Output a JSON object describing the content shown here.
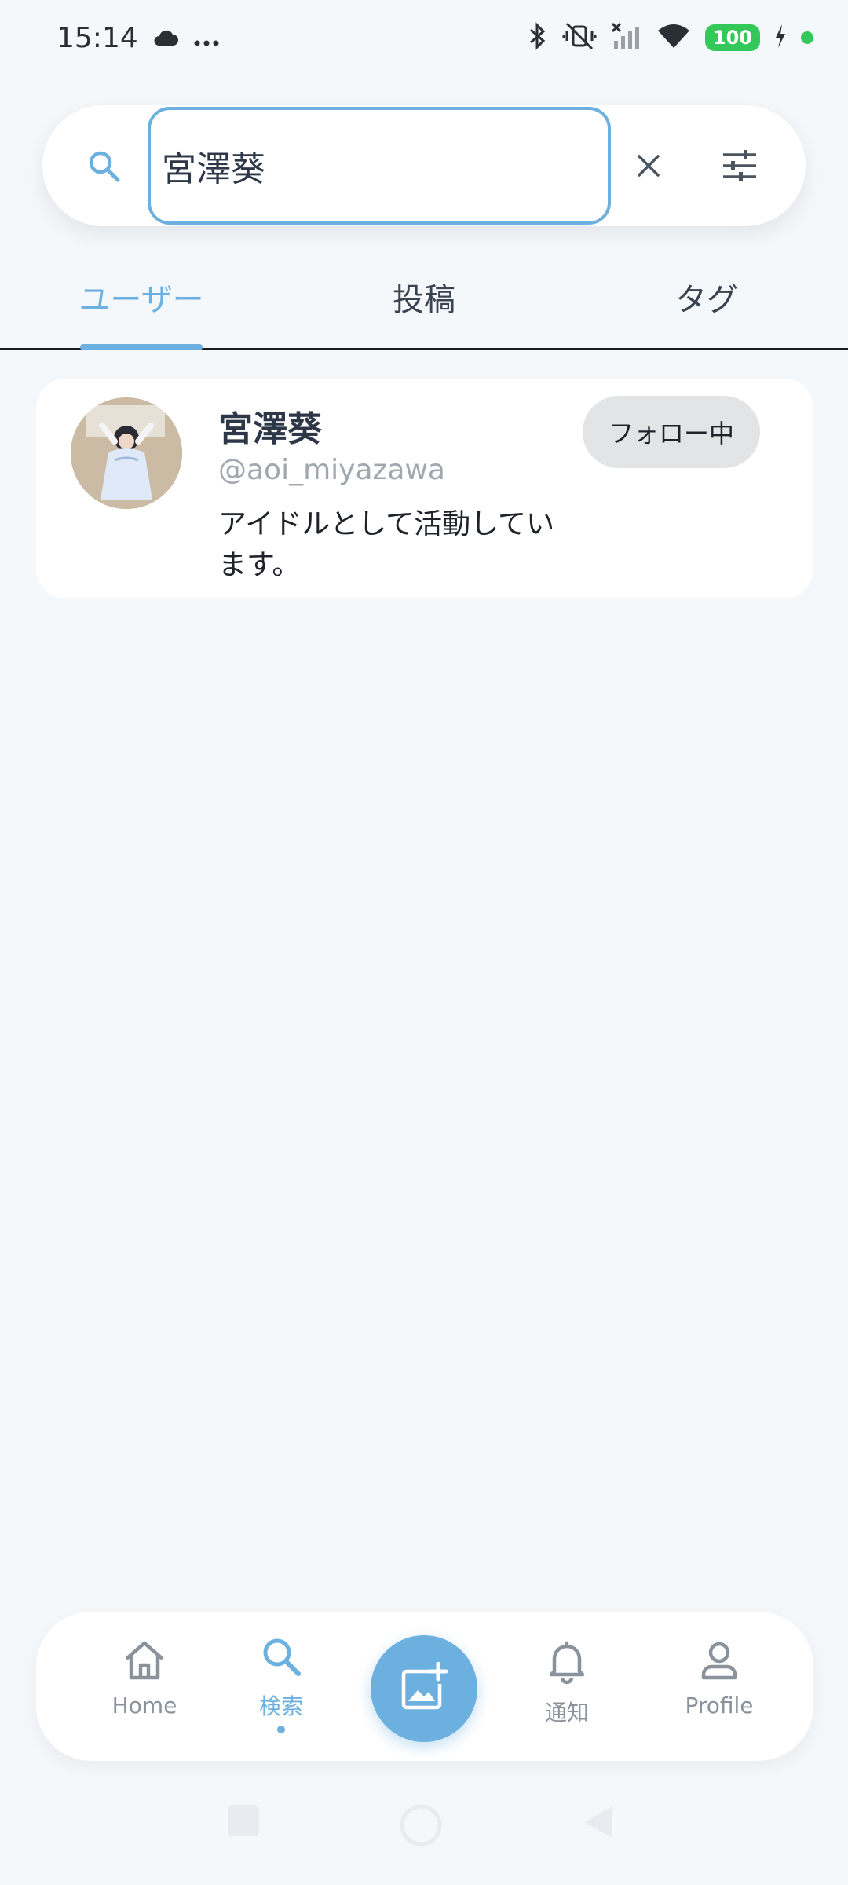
{
  "status_bar": {
    "time": "15:14",
    "battery": "100",
    "icons": [
      "cloud-icon",
      "more-dots-icon",
      "bluetooth-icon",
      "vibrate-off-icon",
      "signal-icon",
      "wifi-icon",
      "charging-icon"
    ]
  },
  "search": {
    "query": "宮澤葵"
  },
  "tabs": [
    {
      "label": "ユーザー",
      "active": true
    },
    {
      "label": "投稿",
      "active": false
    },
    {
      "label": "タグ",
      "active": false
    }
  ],
  "results": [
    {
      "name": "宮澤葵",
      "handle": "@aoi_miyazawa",
      "bio": "アイドルとして活動しています。",
      "follow_label": "フォロー中"
    }
  ],
  "bottom_nav": {
    "home": "Home",
    "search": "検索",
    "notifications": "通知",
    "profile": "Profile"
  },
  "colors": {
    "accent": "#6cb0e0",
    "background": "#f5f8fb",
    "battery": "#34c759"
  }
}
